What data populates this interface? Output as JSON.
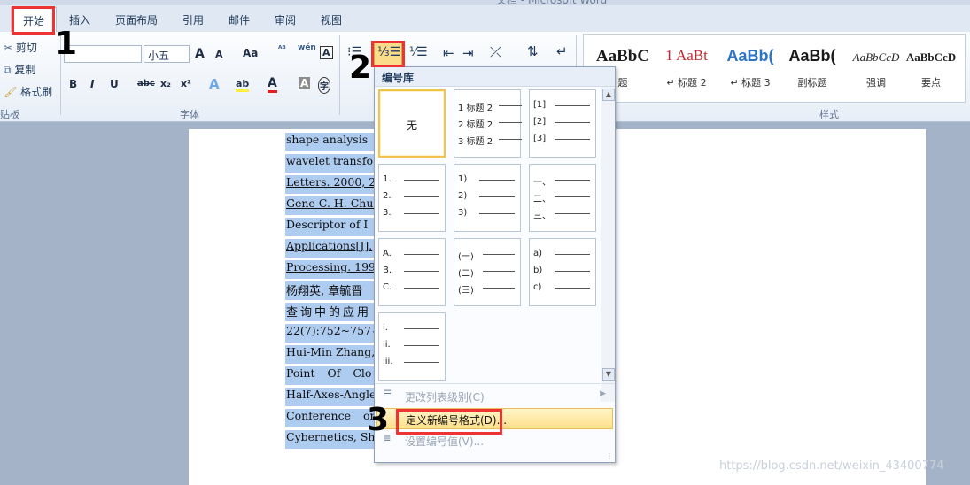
{
  "window": {
    "title": "文档 - Microsoft Word"
  },
  "tabs": [
    "开始",
    "插入",
    "页面布局",
    "引用",
    "邮件",
    "审阅",
    "视图"
  ],
  "clipboard": {
    "cut": "剪切",
    "copy": "复制",
    "format_painter": "格式刷",
    "label": "贴板"
  },
  "font": {
    "name": "",
    "size": "小五",
    "label": "字体",
    "grow": "A",
    "shrink": "A",
    "case": "Aa",
    "clear": "ᴬᴮ",
    "phonetic": "wén",
    "border_char": "A",
    "bold": "B",
    "italic": "I",
    "underline": "U",
    "strike": "abc",
    "sub": "x₂",
    "sup": "x²",
    "effects": "A",
    "highlight": "ab",
    "color": "A",
    "shade": "A",
    "enclose": "字"
  },
  "styles": {
    "label": "样式",
    "items": [
      {
        "preview": "AaBbC",
        "name": "题"
      },
      {
        "preview": "1 AaBt",
        "name": "↵ 标题 2"
      },
      {
        "preview": "AaBb(",
        "name": "↵ 标题 3"
      },
      {
        "preview": "AaBb(",
        "name": "副标题"
      },
      {
        "preview": "AaBbCcD",
        "name": "强调"
      },
      {
        "preview": "AaBbCcD",
        "name": "要点"
      }
    ]
  },
  "annotations": {
    "mark1": "1",
    "mark2": "2",
    "mark3": "3"
  },
  "document_lines": [
    "shape analysis",
    "wavelet transfo",
    "Letters. 2000, 21:",
    "Gene C. H. Chua",
    "Descriptor of I",
    "Applications[J].",
    "Processing. 1996,",
    "杨翔英, 章毓晋",
    "查询中的应用",
    "22(7):752~757↵",
    "Hui-Min Zhang,",
    "Point Of Clo",
    "Half-Axes-Angle",
    "Conference on",
    "Cybernetics, Sh"
  ],
  "numbering_panel": {
    "title": "编号库",
    "none_label": "无",
    "cells": [
      [
        "1 标题 2",
        "2 标题 2",
        "3 标题 2"
      ],
      [
        "[1]",
        "[2]",
        "[3]"
      ],
      [
        "1.",
        "2.",
        "3."
      ],
      [
        "1)",
        "2)",
        "3)"
      ],
      [
        "一、",
        "二、",
        "三、"
      ],
      [
        "A.",
        "B.",
        "C."
      ],
      [
        "(一)",
        "(二)",
        "(三)"
      ],
      [
        "a)",
        "b)",
        "c)"
      ],
      [
        "i.",
        "ii.",
        "iii."
      ]
    ],
    "menu": [
      {
        "label": "更改列表级别(C)",
        "enabled": false,
        "highlighted": false
      },
      {
        "label": "定义新编号格式(D)...",
        "enabled": true,
        "highlighted": true
      },
      {
        "label": "设置编号值(V)...",
        "enabled": false,
        "highlighted": false
      }
    ]
  },
  "watermark": "https://blog.csdn.net/weixin_43400774"
}
